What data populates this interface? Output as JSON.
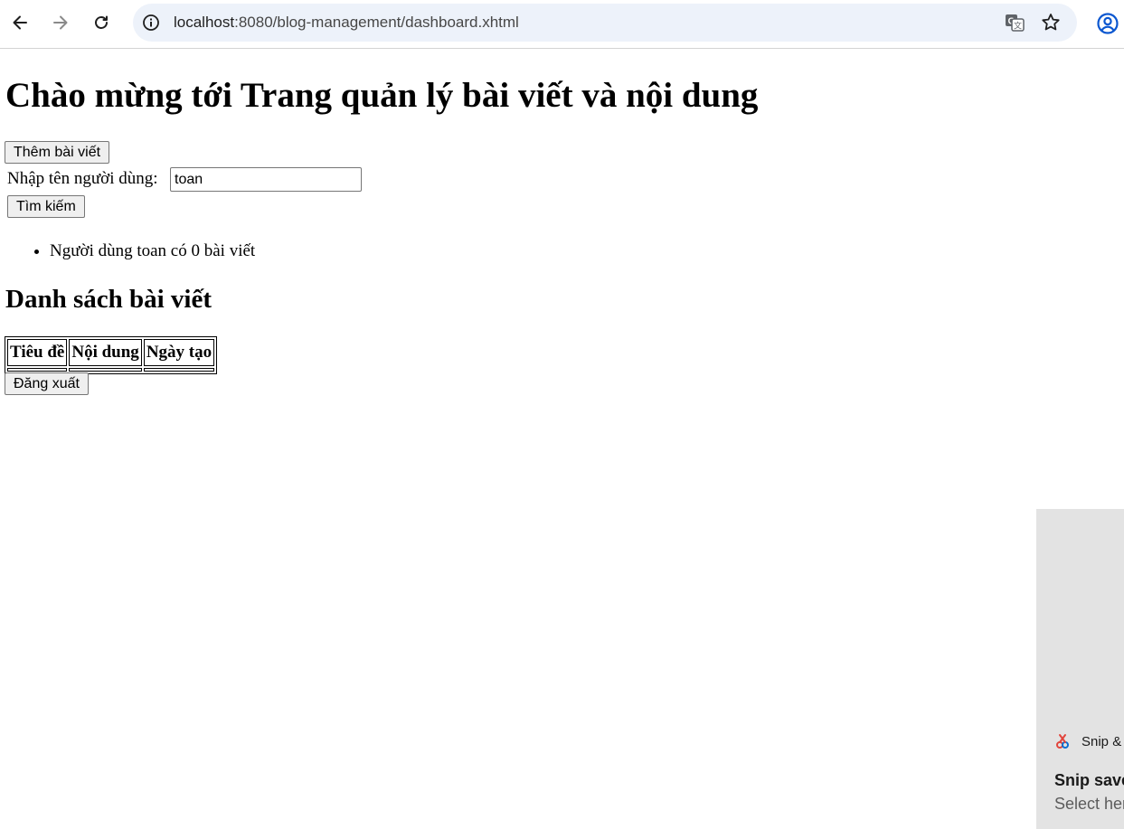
{
  "browser": {
    "url_host": "localhost",
    "url_rest": ":8080/blog-management/dashboard.xhtml",
    "icons": [
      "back-arrow-icon",
      "forward-arrow-icon",
      "reload-icon",
      "info-icon",
      "translate-icon",
      "star-icon",
      "profile-icon"
    ]
  },
  "page": {
    "title": "Chào mừng tới Trang quản lý bài viết và nội dung",
    "add_button": "Thêm bài viết",
    "user_label": "Nhập tên người dùng:",
    "user_input_value": "toan",
    "search_button": "Tìm kiếm",
    "results": [
      "Người dùng toan có 0 bài viết"
    ],
    "list_title": "Danh sách bài viết",
    "table": {
      "headers": [
        "Tiêu đề",
        "Nội dung",
        "Ngày tạo"
      ],
      "rows": []
    },
    "logout_button": "Đăng xuất"
  },
  "notification": {
    "app_name": "Snip &",
    "heading": "Snip save",
    "subtext": "Select her"
  }
}
